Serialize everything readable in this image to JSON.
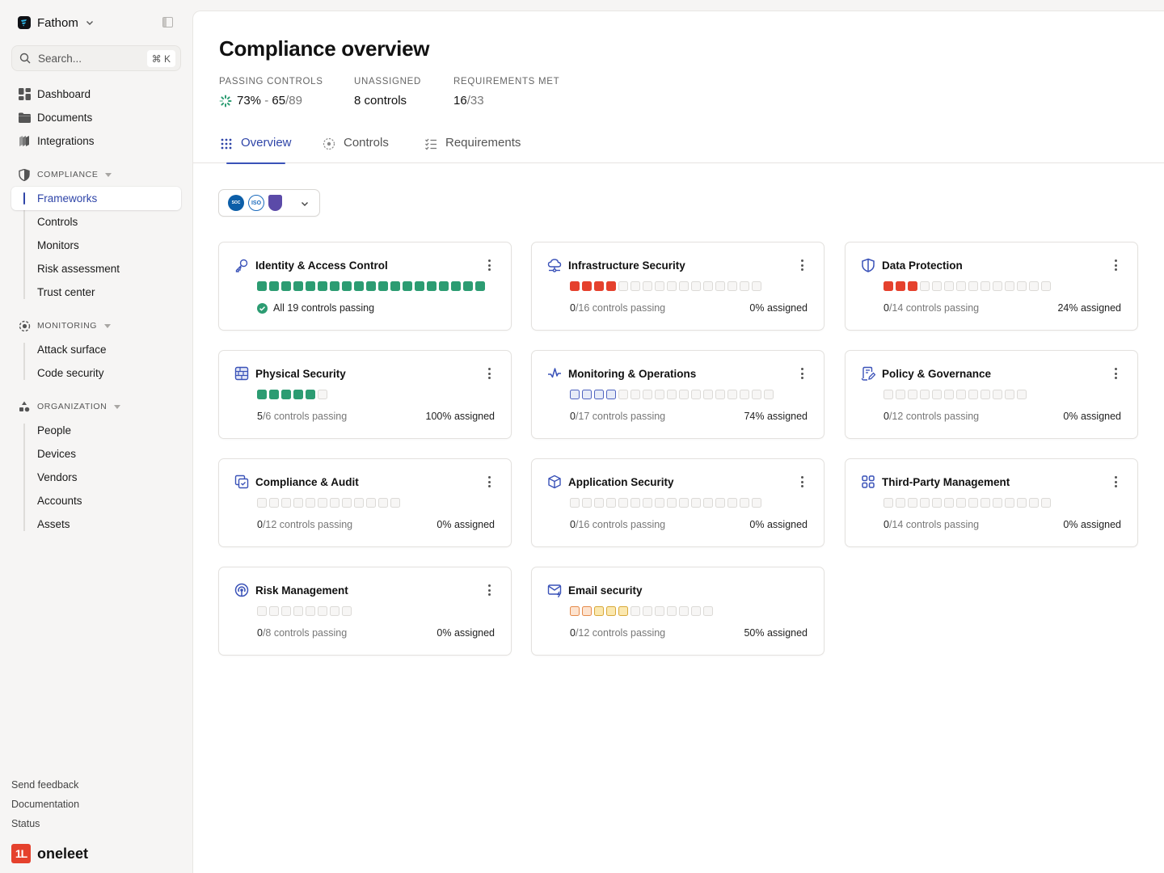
{
  "workspace": {
    "name": "Fathom"
  },
  "search": {
    "placeholder": "Search...",
    "shortcut": "⌘ K"
  },
  "sidebar": {
    "top_items": [
      {
        "label": "Dashboard",
        "icon": "dashboard-icon"
      },
      {
        "label": "Documents",
        "icon": "folder-icon"
      },
      {
        "label": "Integrations",
        "icon": "integrations-icon"
      }
    ],
    "sections": [
      {
        "label": "COMPLIANCE",
        "icon": "shield-icon",
        "items": [
          {
            "label": "Frameworks",
            "active": true
          },
          {
            "label": "Controls"
          },
          {
            "label": "Monitors"
          },
          {
            "label": "Risk assessment"
          },
          {
            "label": "Trust center"
          }
        ]
      },
      {
        "label": "MONITORING",
        "icon": "radar-icon",
        "items": [
          {
            "label": "Attack surface"
          },
          {
            "label": "Code security"
          }
        ]
      },
      {
        "label": "ORGANIZATION",
        "icon": "shapes-icon",
        "items": [
          {
            "label": "People"
          },
          {
            "label": "Devices"
          },
          {
            "label": "Vendors"
          },
          {
            "label": "Accounts"
          },
          {
            "label": "Assets"
          }
        ]
      }
    ],
    "footer_links": [
      "Send feedback",
      "Documentation",
      "Status"
    ],
    "brand": {
      "logo_text": "1L",
      "name": "oneleet"
    }
  },
  "page": {
    "title": "Compliance overview",
    "stats": [
      {
        "label": "PASSING CONTROLS",
        "percent": "73%",
        "sep": " - ",
        "value": "65",
        "total": "/89"
      },
      {
        "label": "UNASSIGNED",
        "value": "8 controls"
      },
      {
        "label": "REQUIREMENTS MET",
        "value": "16",
        "total": "/33"
      }
    ],
    "tabs": [
      {
        "label": "Overview",
        "icon": "grid-dots-icon",
        "active": true
      },
      {
        "label": "Controls",
        "icon": "target-icon"
      },
      {
        "label": "Requirements",
        "icon": "checklist-icon"
      }
    ],
    "framework_filter": {
      "badges": [
        "AICPA SOC",
        "ISO",
        "HIPAA"
      ]
    }
  },
  "colors": {
    "accent": "#2f45a8",
    "passing": "#2c9c72",
    "failing": "#e5412d",
    "in_progress": "#4f64c0",
    "warning_orange": "#e58a4a",
    "warning_yellow": "#d8a93a"
  },
  "cards": [
    {
      "title": "Identity & Access Control",
      "icon": "key-icon",
      "passing": 19,
      "total": 19,
      "segments": {
        "pass": 19
      },
      "status_text": "All 19 controls passing",
      "all_passing": true
    },
    {
      "title": "Infrastructure Security",
      "icon": "cloud-network-icon",
      "passing": 0,
      "total": 16,
      "segments": {
        "fail": 4
      },
      "passing_text": "0",
      "total_text": "/16 controls passing",
      "assigned": "0% assigned"
    },
    {
      "title": "Data Protection",
      "icon": "shield-half-icon",
      "passing": 0,
      "total": 14,
      "segments": {
        "fail": 3
      },
      "passing_text": "0",
      "total_text": "/14 controls passing",
      "assigned": "24% assigned"
    },
    {
      "title": "Physical Security",
      "icon": "brick-wall-icon",
      "passing": 5,
      "total": 6,
      "segments": {
        "pass": 5
      },
      "passing_text": "5",
      "total_text": "/6 controls passing",
      "assigned": "100% assigned"
    },
    {
      "title": "Monitoring & Operations",
      "icon": "activity-icon",
      "passing": 0,
      "total": 17,
      "segments": {
        "prog": 4
      },
      "passing_text": "0",
      "total_text": "/17 controls passing",
      "assigned": "74% assigned"
    },
    {
      "title": "Policy & Governance",
      "icon": "document-edit-icon",
      "passing": 0,
      "total": 12,
      "segments": {},
      "passing_text": "0",
      "total_text": "/12 controls passing",
      "assigned": "0% assigned"
    },
    {
      "title": "Compliance & Audit",
      "icon": "copy-check-icon",
      "passing": 0,
      "total": 12,
      "segments": {},
      "passing_text": "0",
      "total_text": "/12 controls passing",
      "assigned": "0% assigned"
    },
    {
      "title": "Application Security",
      "icon": "box-icon",
      "passing": 0,
      "total": 16,
      "segments": {},
      "passing_text": "0",
      "total_text": "/16 controls passing",
      "assigned": "0% assigned"
    },
    {
      "title": "Third-Party Management",
      "icon": "apps-grid-icon",
      "passing": 0,
      "total": 14,
      "segments": {},
      "passing_text": "0",
      "total_text": "/14 controls passing",
      "assigned": "0% assigned"
    },
    {
      "title": "Risk Management",
      "icon": "radar-signal-icon",
      "passing": 0,
      "total": 8,
      "segments": {},
      "passing_text": "0",
      "total_text": "/8 controls passing",
      "assigned": "0% assigned"
    },
    {
      "title": "Email security",
      "icon": "mail-bolt-icon",
      "passing": 0,
      "total": 12,
      "segments": {
        "warnO": 2,
        "warnY": 3
      },
      "passing_text": "0",
      "total_text": "/12 controls passing",
      "assigned": "50% assigned",
      "no_menu": true
    }
  ]
}
